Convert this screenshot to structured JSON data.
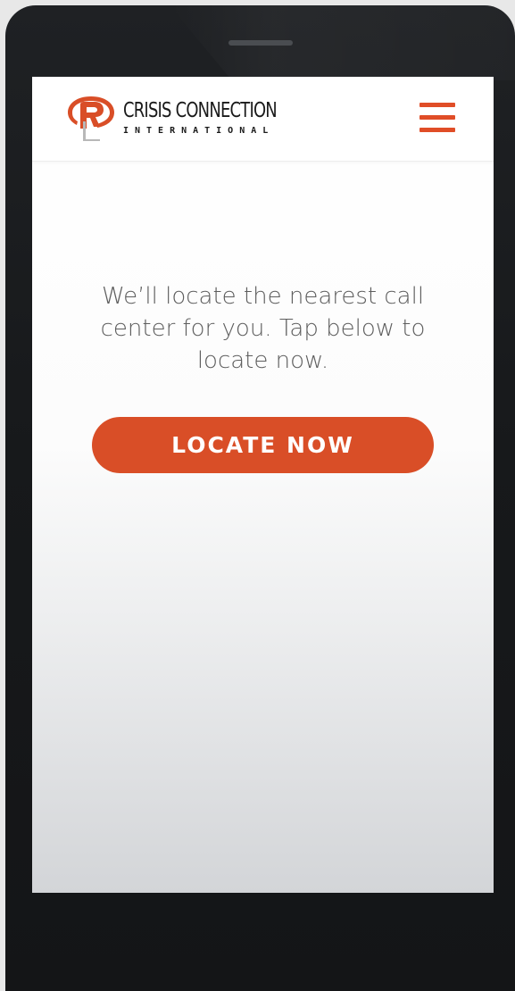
{
  "app": {
    "brand_name": "CRISIS CONNECTION",
    "brand_subtitle": "INTERNATIONAL",
    "brand_color": "#d94e27"
  },
  "header": {
    "logo_icon": "crisis-connection-logo-icon",
    "menu_icon": "hamburger-menu-icon"
  },
  "main": {
    "message": "We’ll locate the nearest call center for you. Tap below to locate now.",
    "button_label": "LOCATE NOW"
  }
}
